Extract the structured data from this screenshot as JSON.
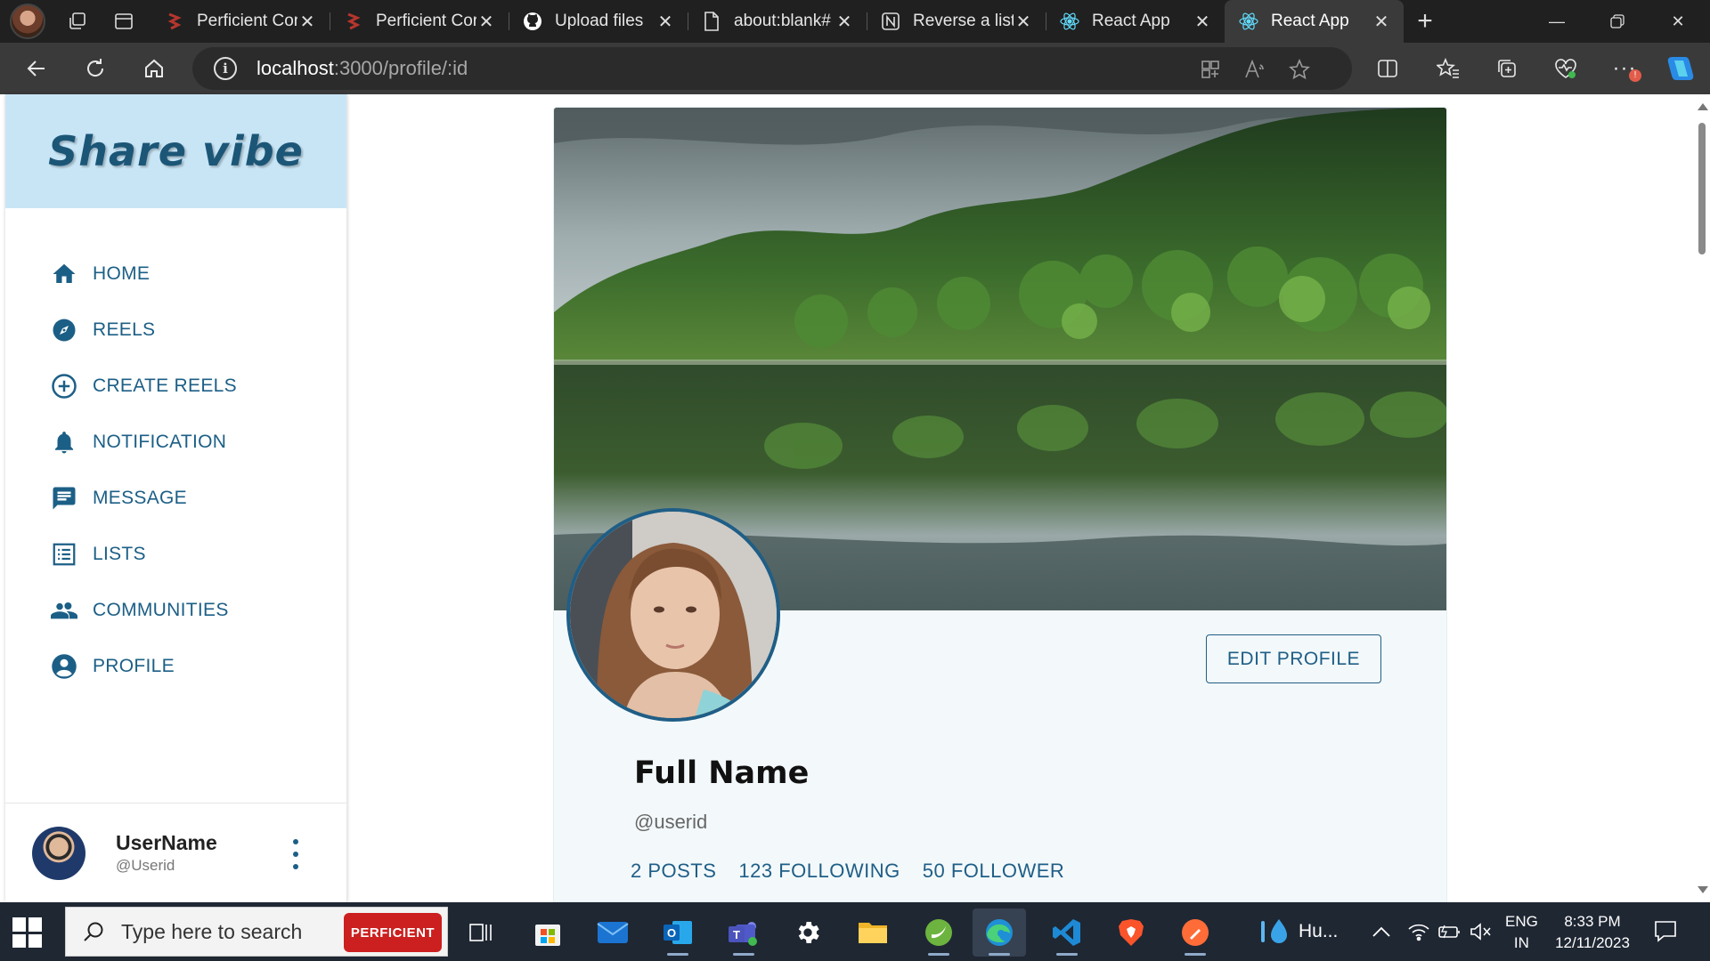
{
  "browser": {
    "tabs": [
      {
        "title": "Perficient Cor",
        "favicon": "perficient-icon"
      },
      {
        "title": "Perficient Cor",
        "favicon": "perficient-icon"
      },
      {
        "title": "Upload files",
        "favicon": "github-icon"
      },
      {
        "title": "about:blank#",
        "favicon": "page-icon"
      },
      {
        "title": "Reverse a list",
        "favicon": "notion-icon"
      },
      {
        "title": "React App",
        "favicon": "react-icon"
      },
      {
        "title": "React App",
        "favicon": "react-icon",
        "active": true
      }
    ],
    "new_tab": "+",
    "url_host": "localhost",
    "url_path": ":3000/profile/:id"
  },
  "sidebar": {
    "brand": "Share vibe",
    "items": [
      {
        "label": "HOME",
        "icon": "home-icon"
      },
      {
        "label": "REELS",
        "icon": "compass-icon"
      },
      {
        "label": "CREATE REELS",
        "icon": "add-circle-icon"
      },
      {
        "label": "NOTIFICATION",
        "icon": "bell-icon"
      },
      {
        "label": "MESSAGE",
        "icon": "message-icon"
      },
      {
        "label": "LISTS",
        "icon": "list-icon"
      },
      {
        "label": "COMMUNITIES",
        "icon": "people-icon"
      },
      {
        "label": "PROFILE",
        "icon": "account-circle-icon"
      }
    ],
    "user": {
      "name": "UserName",
      "id": "@Userid"
    }
  },
  "profile": {
    "edit_button": "EDIT PROFILE",
    "full_name": "Full Name",
    "handle": "@userid",
    "stats": [
      "2 POSTS",
      "123 FOLLOWING",
      "50 FOLLOWER"
    ]
  },
  "taskbar": {
    "search_placeholder": "Type here to search",
    "search_promo": "PERFICIENT",
    "weather_text": "Hu...",
    "lang_line1": "ENG",
    "lang_line2": "IN",
    "time": "8:33 PM",
    "date": "12/11/2023"
  },
  "colors": {
    "accent": "#1f5e86",
    "brand_bg": "#c8e5f6",
    "card_bg": "#f3f9fb"
  }
}
